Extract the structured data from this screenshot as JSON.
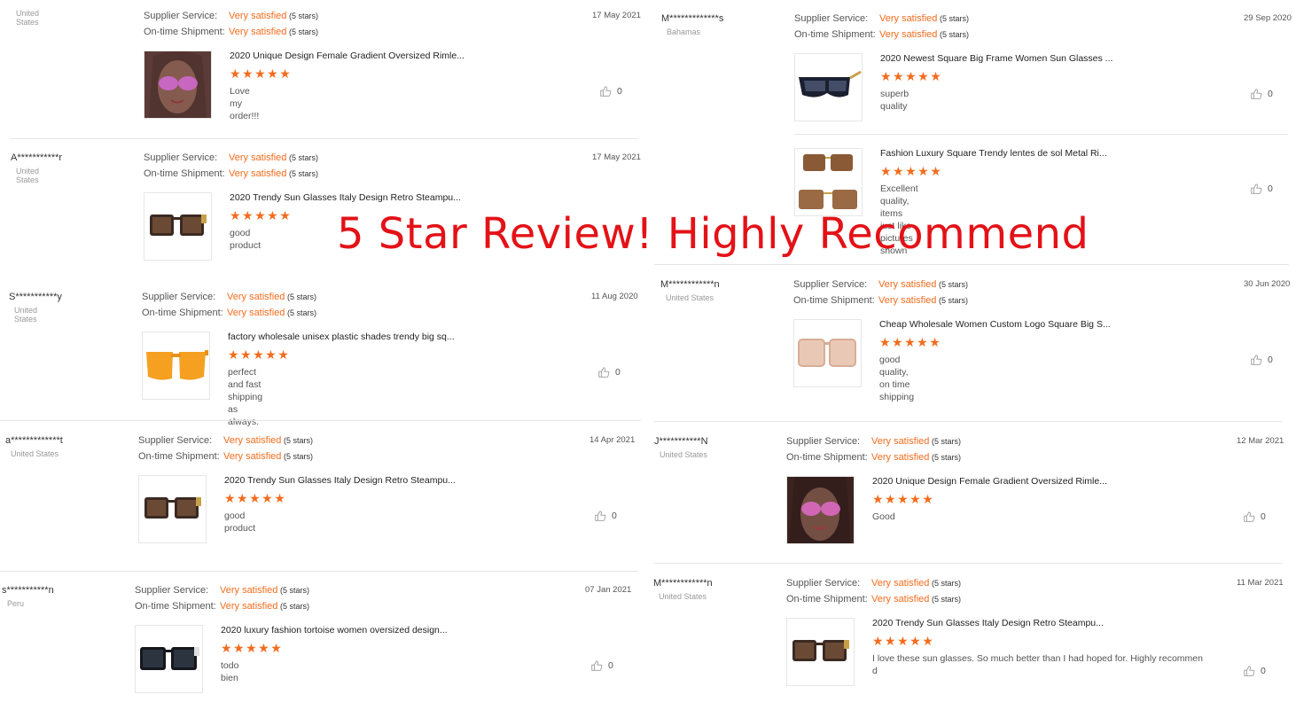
{
  "banner": "5 Star Review! Highly Recommend",
  "labels": {
    "supplier_service": "Supplier Service:",
    "ontime_shipment": "On-time Shipment:",
    "very_satisfied": "Very satisfied",
    "five_stars": "(5 stars)",
    "stars_glyph": "★★★★★"
  },
  "reviews": [
    {
      "user": "",
      "country": "United States",
      "date": "17 May 2021",
      "product": "2020 Unique Design Female Gradient Oversized Rimle...",
      "comment": "Love my order!!!",
      "likes": "0"
    },
    {
      "user": "A***********r",
      "country": "United States",
      "date": "17 May 2021",
      "product": "2020 Trendy Sun Glasses Italy Design Retro Steampu...",
      "comment": "good product",
      "likes": "0"
    },
    {
      "user": "S***********y",
      "country": "United States",
      "date": "11 Aug 2020",
      "product": "factory wholesale unisex plastic shades trendy big sq...",
      "comment": "perfect and fast shipping as always.",
      "likes": "0"
    },
    {
      "user": "a*************t",
      "country": "United States",
      "date": "14 Apr 2021",
      "product": "2020 Trendy Sun Glasses Italy Design Retro Steampu...",
      "comment": "good product",
      "likes": "0"
    },
    {
      "user": "s***********n",
      "country": "Peru",
      "date": "07 Jan 2021",
      "product": "2020 luxury fashion tortoise women oversized design...",
      "comment": "todo bien",
      "likes": "0"
    },
    {
      "user": "M*************s",
      "country": "Bahamas",
      "date": "29 Sep 2020",
      "product": "2020 Newest Square Big Frame Women Sun Glasses ...",
      "comment": "superb quality",
      "likes": "0"
    },
    {
      "user": "",
      "country": "",
      "date": "",
      "product": "Fashion Luxury Square Trendy lentes de sol Metal Ri...",
      "comment": "Excellent quality, items just like pictures shown",
      "likes": "0"
    },
    {
      "user": "M************n",
      "country": "United States",
      "date": "30 Jun 2020",
      "product": "Cheap Wholesale Women Custom Logo Square Big S...",
      "comment": "good quality, on time shipping",
      "likes": "0"
    },
    {
      "user": "J***********N",
      "country": "United States",
      "date": "12 Mar 2021",
      "product": "2020 Unique Design Female Gradient Oversized Rimle...",
      "comment": "Good",
      "likes": "0"
    },
    {
      "user": "M************n",
      "country": "United States",
      "date": "11 Mar 2021",
      "product": "2020 Trendy Sun Glasses Italy Design Retro Steampu...",
      "comment": "I love these sun glasses.  So much better than I had hoped for.  Highly recommen",
      "comment2": "d",
      "likes": "0"
    }
  ]
}
